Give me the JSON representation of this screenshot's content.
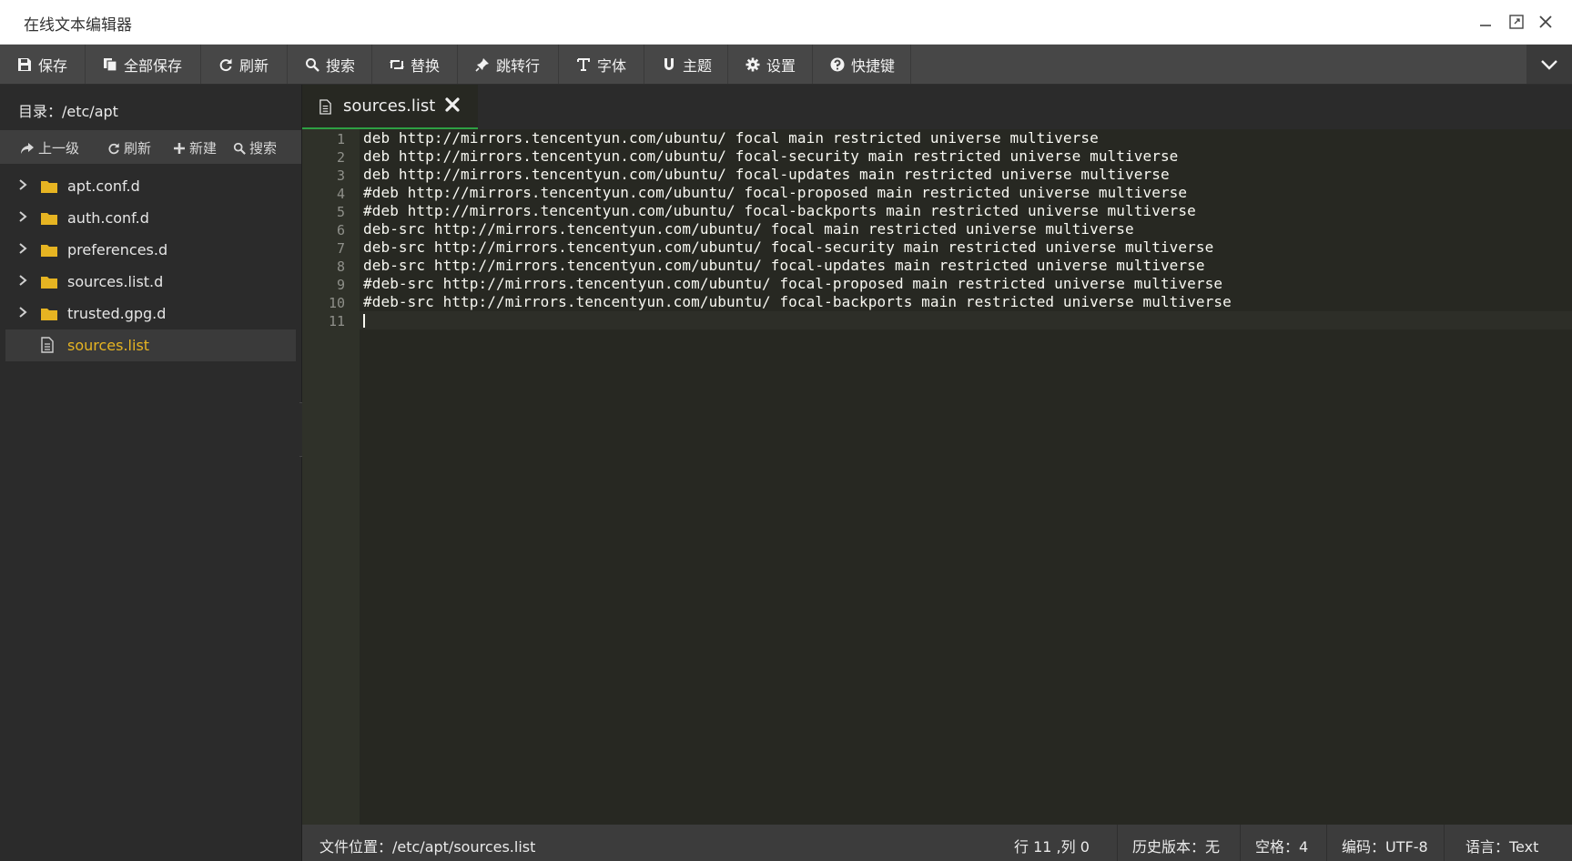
{
  "window": {
    "title": "在线文本编辑器"
  },
  "toolbar": {
    "save": "保存",
    "save_all": "全部保存",
    "refresh": "刷新",
    "search": "搜索",
    "replace": "替换",
    "goto_line": "跳转行",
    "font": "字体",
    "theme": "主题",
    "settings": "设置",
    "shortcuts": "快捷键"
  },
  "sidebar": {
    "directory": "目录：/etc/apt",
    "actions": {
      "up": "上一级",
      "refresh": "刷新",
      "new": "新建",
      "search": "搜索"
    },
    "items": [
      {
        "label": "apt.conf.d",
        "type": "folder"
      },
      {
        "label": "auth.conf.d",
        "type": "folder"
      },
      {
        "label": "preferences.d",
        "type": "folder"
      },
      {
        "label": "sources.list.d",
        "type": "folder"
      },
      {
        "label": "trusted.gpg.d",
        "type": "folder"
      },
      {
        "label": "sources.list",
        "type": "file",
        "selected": true
      }
    ]
  },
  "editor": {
    "tab_label": "sources.list",
    "lines": [
      "deb http://mirrors.tencentyun.com/ubuntu/ focal main restricted universe multiverse",
      "deb http://mirrors.tencentyun.com/ubuntu/ focal-security main restricted universe multiverse",
      "deb http://mirrors.tencentyun.com/ubuntu/ focal-updates main restricted universe multiverse",
      "#deb http://mirrors.tencentyun.com/ubuntu/ focal-proposed main restricted universe multiverse",
      "#deb http://mirrors.tencentyun.com/ubuntu/ focal-backports main restricted universe multiverse",
      "deb-src http://mirrors.tencentyun.com/ubuntu/ focal main restricted universe multiverse",
      "deb-src http://mirrors.tencentyun.com/ubuntu/ focal-security main restricted universe multiverse",
      "deb-src http://mirrors.tencentyun.com/ubuntu/ focal-updates main restricted universe multiverse",
      "#deb-src http://mirrors.tencentyun.com/ubuntu/ focal-proposed main restricted universe multiverse",
      "#deb-src http://mirrors.tencentyun.com/ubuntu/ focal-backports main restricted universe multiverse",
      ""
    ],
    "line_numbers": [
      "1",
      "2",
      "3",
      "4",
      "5",
      "6",
      "7",
      "8",
      "9",
      "10",
      "11"
    ]
  },
  "statusbar": {
    "file_location": "文件位置：/etc/apt/sources.list",
    "cursor": "行 11 ,列 0",
    "history": "历史版本：无",
    "indent": "空格：4",
    "encoding": "编码：UTF-8",
    "language": "语言：Text"
  },
  "colors": {
    "accent_tab_underline": "#2ea043",
    "selected_file": "#e6b422",
    "folder": "#e6b422",
    "editor_bg": "#272822"
  }
}
